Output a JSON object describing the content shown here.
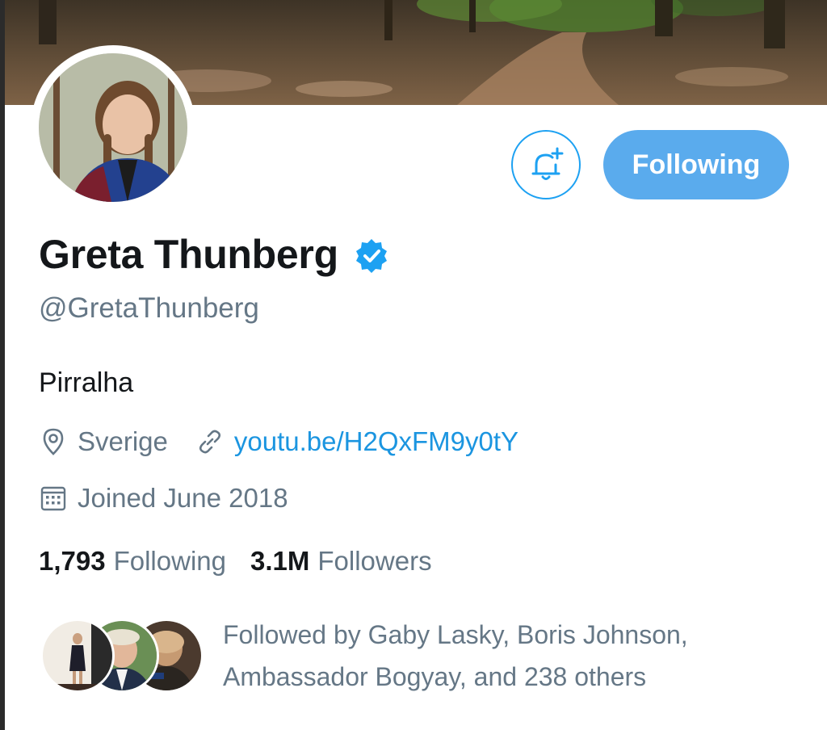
{
  "profile": {
    "name": "Greta Thunberg",
    "handle": "@GretaThunberg",
    "bio": "Pirralha",
    "location": "Sverige",
    "url": "youtu.be/H2QxFM9y0tY",
    "joined": "Joined June 2018",
    "verified": true
  },
  "actions": {
    "follow_label": "Following",
    "notify_icon": "bell-plus-icon"
  },
  "stats": {
    "following_count": "1,793",
    "following_label": "Following",
    "followers_count": "3.1M",
    "followers_label": "Followers"
  },
  "followed_by": {
    "text_line1": "Followed by Gaby Lasky, Boris Johnson,",
    "text_line2": "Ambassador Bogyay, and 238 others"
  },
  "colors": {
    "accent": "#1da1f2",
    "button_fill": "#5aabed",
    "link": "#1b95e0",
    "muted": "#657786",
    "text": "#14171a"
  }
}
